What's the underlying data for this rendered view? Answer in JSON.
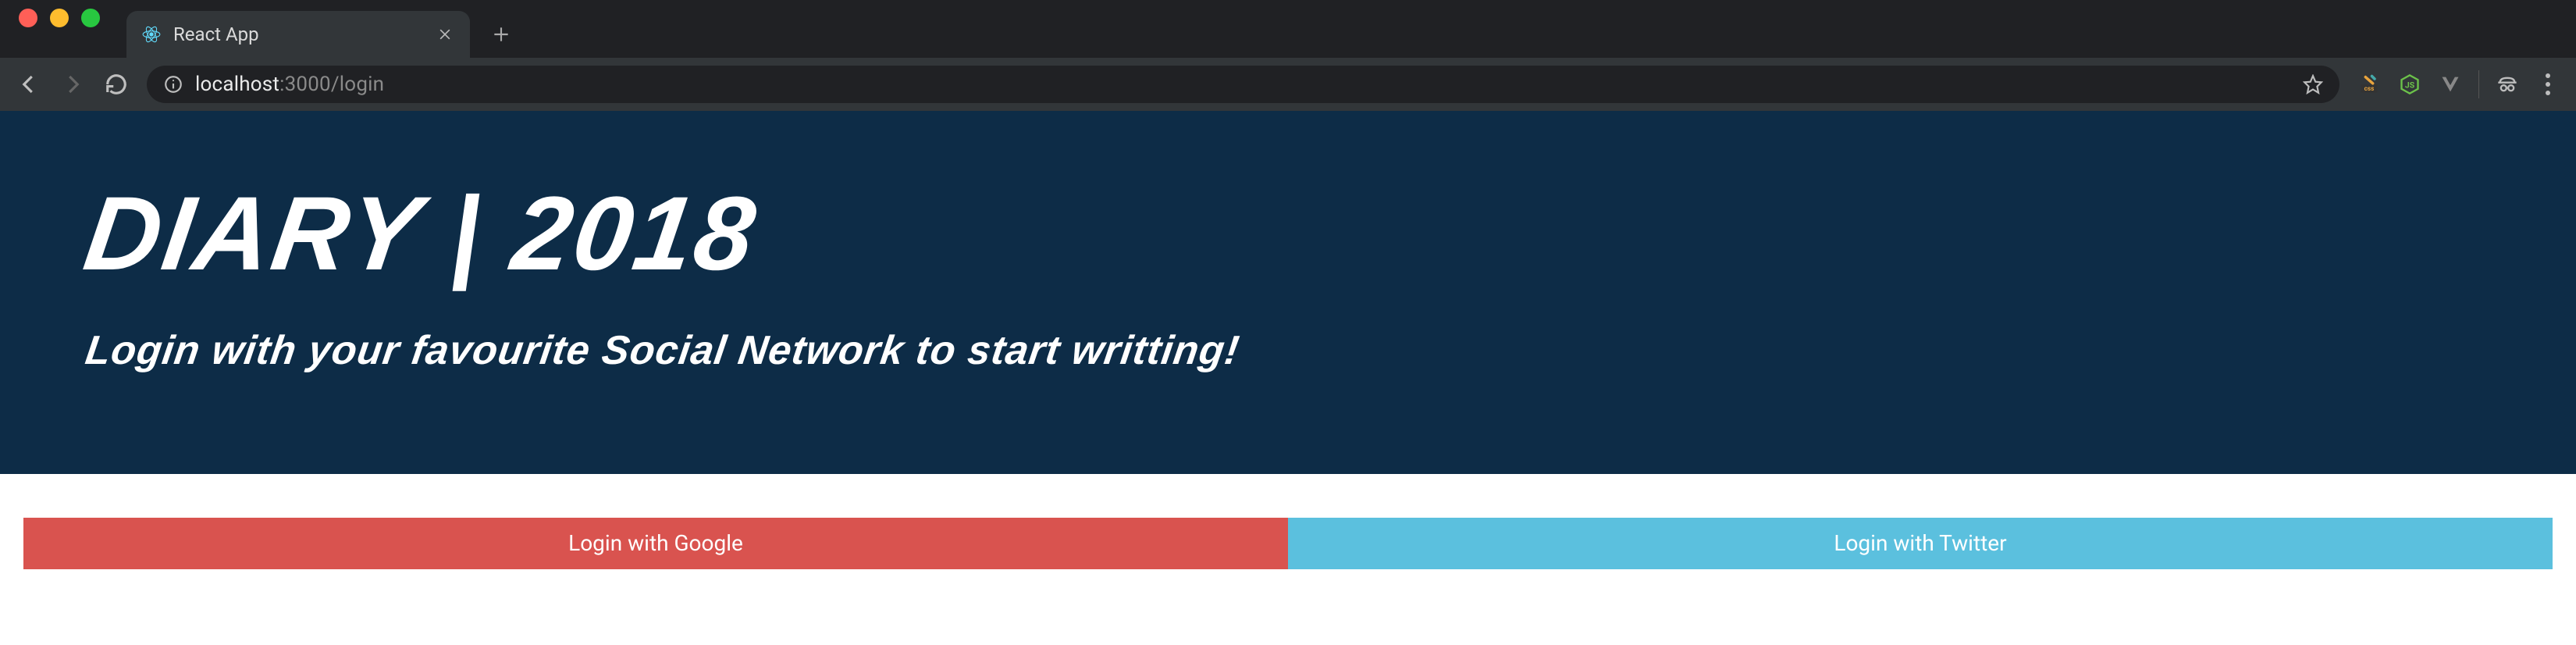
{
  "browser": {
    "tab_title": "React App",
    "url_host": "localhost",
    "url_rest": ":3000/login"
  },
  "hero": {
    "title": "DIARY | 2018",
    "subtitle": "Login with your favourite Social Network to start writting!"
  },
  "buttons": {
    "google": "Login with Google",
    "twitter": "Login with Twitter"
  },
  "colors": {
    "hero_bg": "#0d2c47",
    "google_btn": "#d9534f",
    "twitter_btn": "#5bc0de"
  }
}
